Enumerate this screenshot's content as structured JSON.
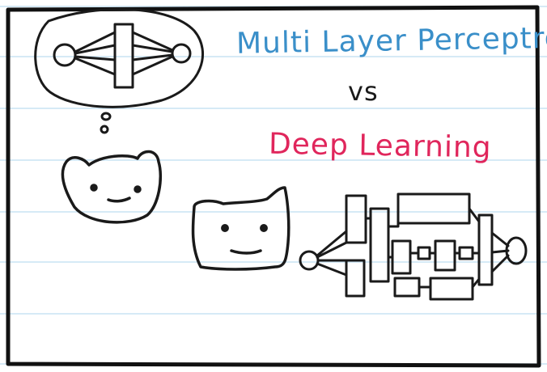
{
  "titles": {
    "mlp": "Multi Layer Perceptron",
    "vs": "vs",
    "dl": "Deep Learning"
  },
  "colors": {
    "mlp": "#3a8fc9",
    "vs": "#1a1a1a",
    "dl": "#e0265c",
    "ink": "#1a1a1a",
    "ruled_line": "#c9e3f4",
    "border": "#111111"
  },
  "illustration": {
    "ruled_paper": true,
    "small_creature": "bear-like creature with a thought bubble picturing a simple multilayer perceptron",
    "big_creature": "cat-like creature connected to a complex deep learning network diagram"
  }
}
